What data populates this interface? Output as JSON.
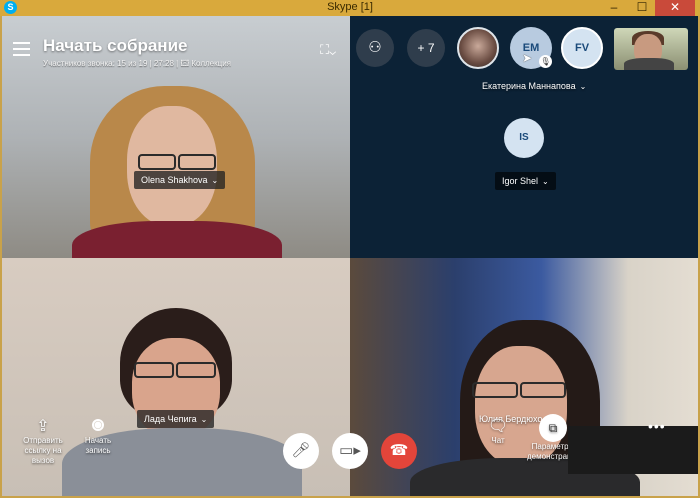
{
  "window": {
    "title": "Skype [1]",
    "app_icon": "S",
    "minimize": "–",
    "maximize": "☐",
    "close": "✕"
  },
  "header": {
    "meeting_title": "Начать собрание",
    "subtitle": "Участников звонка: 15 из 19 | 27:28 | 🖾 Коллекция"
  },
  "participants": {
    "more_count": "+ 7",
    "em_initials": "EM",
    "fv_initials": "FV",
    "is_initials": "IS",
    "em_name": "Екатерина Маннапова",
    "is_name": "Igor Shel"
  },
  "video_tiles": [
    {
      "name": "Olena Shakhova"
    },
    {
      "name": "Лада Чепига"
    },
    {
      "name": "Юлия Бердюхо"
    }
  ],
  "controls": {
    "share_link_label": "Отправить ссылку на вызов",
    "start_record_label": "Начать запись",
    "chat_label": "Чат",
    "share_screen_label": "Параметры демонстрации",
    "more": "•••"
  },
  "colors": {
    "end_call": "#e3453a",
    "title_bar": "#d9a93c",
    "avatar_bg": "#d4e3f1"
  }
}
